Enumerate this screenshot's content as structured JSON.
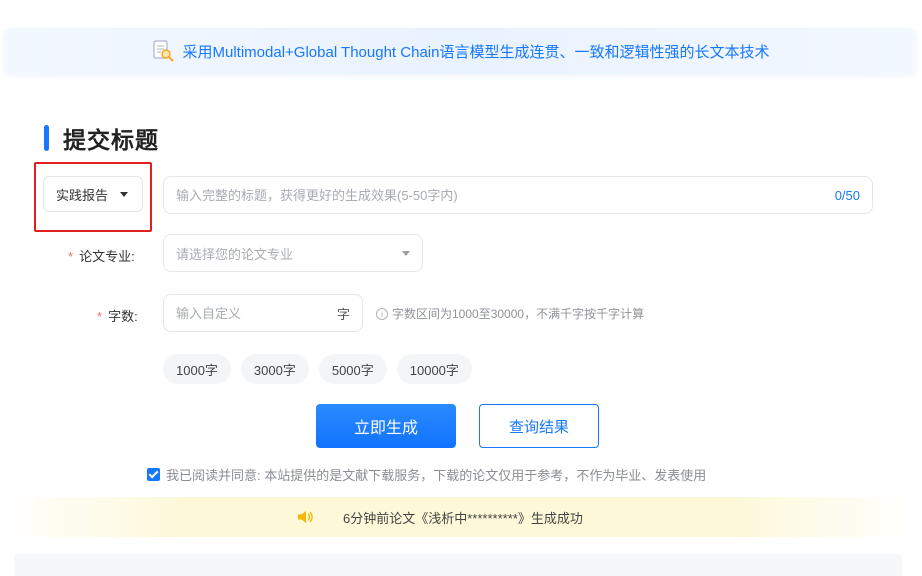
{
  "banner": {
    "text": "采用Multimodal+Global Thought Chain语言模型生成连贯、一致和逻辑性强的长文本技术",
    "icon": "document-search-icon"
  },
  "section": {
    "title": "提交标题"
  },
  "type_select": {
    "value": "实践报告"
  },
  "title_input": {
    "placeholder": "输入完整的标题，获得更好的生成效果(5-50字内)",
    "value": "",
    "counter": "0/50"
  },
  "major": {
    "label": "论文专业:",
    "placeholder": "请选择您的论文专业"
  },
  "word_count": {
    "label": "字数:",
    "placeholder": "输入自定义",
    "suffix": "字",
    "hint": "字数区间为1000至30000，不满千字按千字计算"
  },
  "presets": [
    "1000字",
    "3000字",
    "5000字",
    "10000字"
  ],
  "actions": {
    "generate": "立即生成",
    "query": "查询结果"
  },
  "agreement": {
    "checked": true,
    "text": "我已阅读并同意: 本站提供的是文献下载服务，下载的论文仅用于参考，不作为毕业、发表使用"
  },
  "notice": {
    "text": "6分钟前论文《浅析中**********》生成成功"
  },
  "colors": {
    "accent": "#1677ff",
    "required": "#f56c6c",
    "highlight": "#e02020",
    "notice_bg": "#fdf8d8"
  }
}
